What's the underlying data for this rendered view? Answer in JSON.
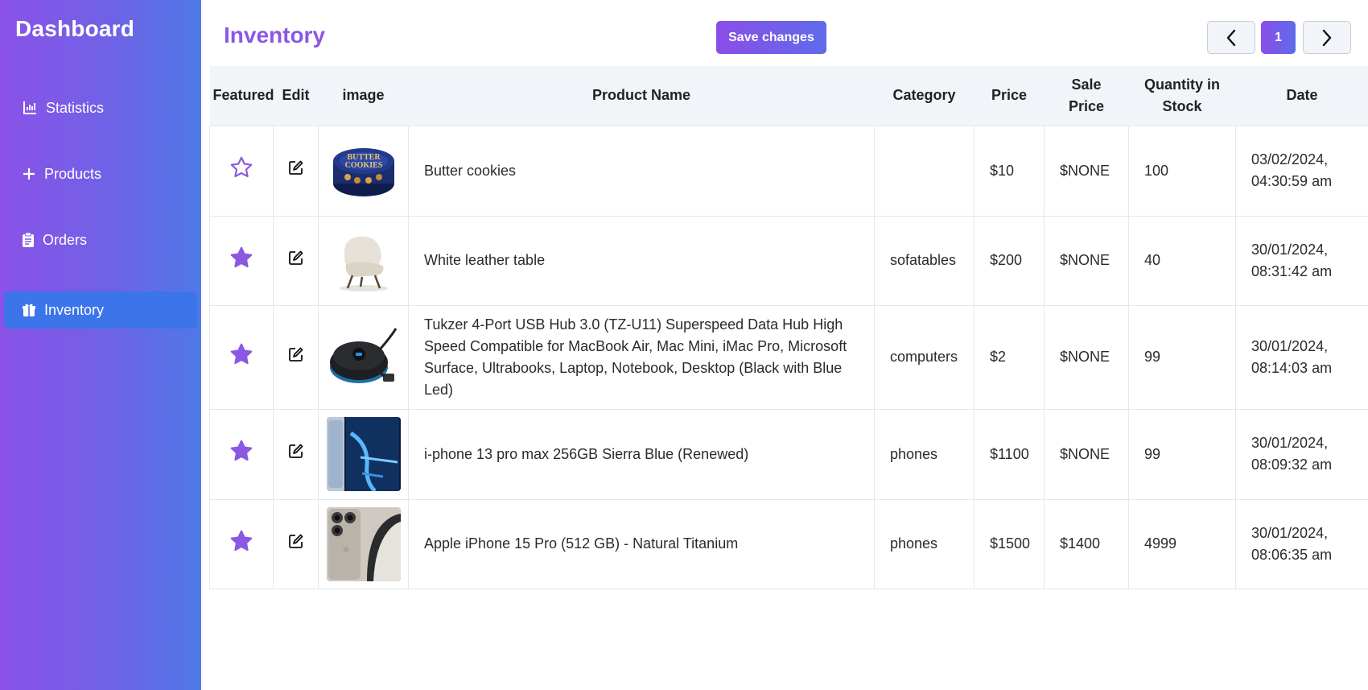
{
  "sidebar": {
    "brand": "Dashboard",
    "items": [
      {
        "label": "Statistics",
        "icon": "chart-icon"
      },
      {
        "label": "Products",
        "icon": "plus-icon"
      },
      {
        "label": "Orders",
        "icon": "clipboard-icon"
      },
      {
        "label": "Inventory",
        "icon": "gift-icon",
        "active": true
      }
    ]
  },
  "header": {
    "title": "Inventory",
    "save_label": "Save changes",
    "page_number": "1"
  },
  "table": {
    "columns": [
      "Featured",
      "Edit",
      "image",
      "Product Name",
      "Category",
      "Price",
      "Sale Price",
      "Quantity in Stock",
      "Date"
    ],
    "rows": [
      {
        "featured": false,
        "image": "butter-cookies-tin",
        "name": "Butter cookies",
        "category": "",
        "price": "$10",
        "sale_price": "$NONE",
        "quantity": "100",
        "date_line1": "03/02/2024,",
        "date_line2": "04:30:59 am"
      },
      {
        "featured": true,
        "image": "white-leather-chair",
        "name": "White leather table",
        "category": "sofatables",
        "price": "$200",
        "sale_price": "$NONE",
        "quantity": "40",
        "date_line1": "30/01/2024,",
        "date_line2": "08:31:42 am"
      },
      {
        "featured": true,
        "image": "usb-hub",
        "name": "Tukzer 4-Port USB Hub 3.0 (TZ-U11) Superspeed Data Hub High Speed Compatible for MacBook Air, Mac Mini, iMac Pro, Microsoft Surface, Ultrabooks, Laptop, Notebook, Desktop (Black with Blue Led)",
        "category": "computers",
        "price": "$2",
        "sale_price": "$NONE",
        "quantity": "99",
        "date_line1": "30/01/2024,",
        "date_line2": "08:14:03 am"
      },
      {
        "featured": true,
        "image": "iphone-13-blue",
        "name": "i-phone 13 pro max 256GB Sierra Blue (Renewed)",
        "category": "phones",
        "price": "$1100",
        "sale_price": "$NONE",
        "quantity": "99",
        "date_line1": "30/01/2024,",
        "date_line2": "08:09:32 am"
      },
      {
        "featured": true,
        "image": "iphone-15-titanium",
        "name": "Apple iPhone 15 Pro (512 GB) - Natural Titanium",
        "category": "phones",
        "price": "$1500",
        "sale_price": "$1400",
        "quantity": "4999",
        "date_line1": "30/01/2024,",
        "date_line2": "08:06:35 am"
      }
    ]
  },
  "colors": {
    "accent": "#8a58e2",
    "star": "#8a58e2",
    "sidebar_active": "#3c74ea"
  }
}
